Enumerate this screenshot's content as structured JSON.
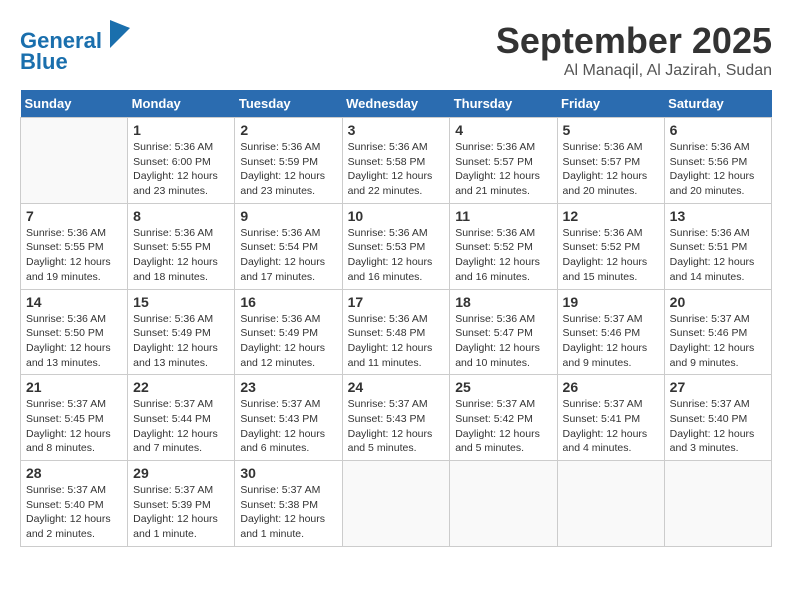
{
  "header": {
    "logo_line1": "General",
    "logo_line2": "Blue",
    "month": "September 2025",
    "location": "Al Manaqil, Al Jazirah, Sudan"
  },
  "days_of_week": [
    "Sunday",
    "Monday",
    "Tuesday",
    "Wednesday",
    "Thursday",
    "Friday",
    "Saturday"
  ],
  "weeks": [
    [
      {
        "day": "",
        "info": ""
      },
      {
        "day": "1",
        "info": "Sunrise: 5:36 AM\nSunset: 6:00 PM\nDaylight: 12 hours\nand 23 minutes."
      },
      {
        "day": "2",
        "info": "Sunrise: 5:36 AM\nSunset: 5:59 PM\nDaylight: 12 hours\nand 23 minutes."
      },
      {
        "day": "3",
        "info": "Sunrise: 5:36 AM\nSunset: 5:58 PM\nDaylight: 12 hours\nand 22 minutes."
      },
      {
        "day": "4",
        "info": "Sunrise: 5:36 AM\nSunset: 5:57 PM\nDaylight: 12 hours\nand 21 minutes."
      },
      {
        "day": "5",
        "info": "Sunrise: 5:36 AM\nSunset: 5:57 PM\nDaylight: 12 hours\nand 20 minutes."
      },
      {
        "day": "6",
        "info": "Sunrise: 5:36 AM\nSunset: 5:56 PM\nDaylight: 12 hours\nand 20 minutes."
      }
    ],
    [
      {
        "day": "7",
        "info": "Sunrise: 5:36 AM\nSunset: 5:55 PM\nDaylight: 12 hours\nand 19 minutes."
      },
      {
        "day": "8",
        "info": "Sunrise: 5:36 AM\nSunset: 5:55 PM\nDaylight: 12 hours\nand 18 minutes."
      },
      {
        "day": "9",
        "info": "Sunrise: 5:36 AM\nSunset: 5:54 PM\nDaylight: 12 hours\nand 17 minutes."
      },
      {
        "day": "10",
        "info": "Sunrise: 5:36 AM\nSunset: 5:53 PM\nDaylight: 12 hours\nand 16 minutes."
      },
      {
        "day": "11",
        "info": "Sunrise: 5:36 AM\nSunset: 5:52 PM\nDaylight: 12 hours\nand 16 minutes."
      },
      {
        "day": "12",
        "info": "Sunrise: 5:36 AM\nSunset: 5:52 PM\nDaylight: 12 hours\nand 15 minutes."
      },
      {
        "day": "13",
        "info": "Sunrise: 5:36 AM\nSunset: 5:51 PM\nDaylight: 12 hours\nand 14 minutes."
      }
    ],
    [
      {
        "day": "14",
        "info": "Sunrise: 5:36 AM\nSunset: 5:50 PM\nDaylight: 12 hours\nand 13 minutes."
      },
      {
        "day": "15",
        "info": "Sunrise: 5:36 AM\nSunset: 5:49 PM\nDaylight: 12 hours\nand 13 minutes."
      },
      {
        "day": "16",
        "info": "Sunrise: 5:36 AM\nSunset: 5:49 PM\nDaylight: 12 hours\nand 12 minutes."
      },
      {
        "day": "17",
        "info": "Sunrise: 5:36 AM\nSunset: 5:48 PM\nDaylight: 12 hours\nand 11 minutes."
      },
      {
        "day": "18",
        "info": "Sunrise: 5:36 AM\nSunset: 5:47 PM\nDaylight: 12 hours\nand 10 minutes."
      },
      {
        "day": "19",
        "info": "Sunrise: 5:37 AM\nSunset: 5:46 PM\nDaylight: 12 hours\nand 9 minutes."
      },
      {
        "day": "20",
        "info": "Sunrise: 5:37 AM\nSunset: 5:46 PM\nDaylight: 12 hours\nand 9 minutes."
      }
    ],
    [
      {
        "day": "21",
        "info": "Sunrise: 5:37 AM\nSunset: 5:45 PM\nDaylight: 12 hours\nand 8 minutes."
      },
      {
        "day": "22",
        "info": "Sunrise: 5:37 AM\nSunset: 5:44 PM\nDaylight: 12 hours\nand 7 minutes."
      },
      {
        "day": "23",
        "info": "Sunrise: 5:37 AM\nSunset: 5:43 PM\nDaylight: 12 hours\nand 6 minutes."
      },
      {
        "day": "24",
        "info": "Sunrise: 5:37 AM\nSunset: 5:43 PM\nDaylight: 12 hours\nand 5 minutes."
      },
      {
        "day": "25",
        "info": "Sunrise: 5:37 AM\nSunset: 5:42 PM\nDaylight: 12 hours\nand 5 minutes."
      },
      {
        "day": "26",
        "info": "Sunrise: 5:37 AM\nSunset: 5:41 PM\nDaylight: 12 hours\nand 4 minutes."
      },
      {
        "day": "27",
        "info": "Sunrise: 5:37 AM\nSunset: 5:40 PM\nDaylight: 12 hours\nand 3 minutes."
      }
    ],
    [
      {
        "day": "28",
        "info": "Sunrise: 5:37 AM\nSunset: 5:40 PM\nDaylight: 12 hours\nand 2 minutes."
      },
      {
        "day": "29",
        "info": "Sunrise: 5:37 AM\nSunset: 5:39 PM\nDaylight: 12 hours\nand 1 minute."
      },
      {
        "day": "30",
        "info": "Sunrise: 5:37 AM\nSunset: 5:38 PM\nDaylight: 12 hours\nand 1 minute."
      },
      {
        "day": "",
        "info": ""
      },
      {
        "day": "",
        "info": ""
      },
      {
        "day": "",
        "info": ""
      },
      {
        "day": "",
        "info": ""
      }
    ]
  ]
}
